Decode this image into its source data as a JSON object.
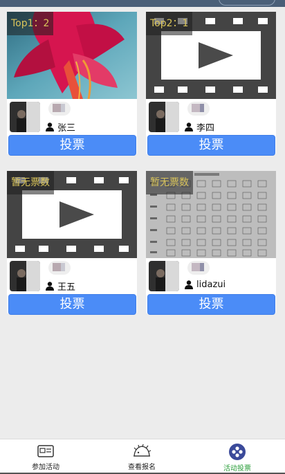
{
  "entries": [
    {
      "rank_label": "Top1：2",
      "user_name": "张三",
      "vote_label": "投票",
      "thumbnail": "flower-photo"
    },
    {
      "rank_label": "Top2：1",
      "user_name": "李四",
      "vote_label": "投票",
      "thumbnail": "video-placeholder"
    },
    {
      "rank_label": "暂无票数",
      "user_name": "王五",
      "vote_label": "投票",
      "thumbnail": "video-placeholder"
    },
    {
      "rank_label": "暂无票数",
      "user_name": "lidazui",
      "vote_label": "投票",
      "thumbnail": "chord-chart"
    }
  ],
  "tabs": [
    {
      "label": "参加活动",
      "icon": "id-card-icon",
      "active": false
    },
    {
      "label": "查看报名",
      "icon": "hedgehog-icon",
      "active": false
    },
    {
      "label": "活动投票",
      "icon": "vote-dots-icon",
      "active": true
    }
  ],
  "colors": {
    "vote_button": "#4b8cf7",
    "rank_text": "#d9c45a",
    "active_tab": "#2a9e3a"
  }
}
